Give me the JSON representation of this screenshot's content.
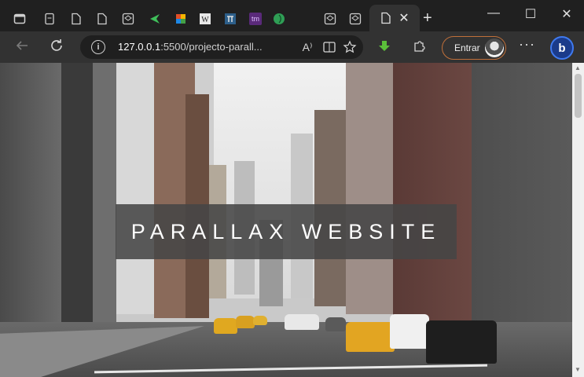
{
  "browser": {
    "tabs": [
      {
        "icon": "tab-actions-icon"
      },
      {
        "icon": "page-icon"
      },
      {
        "icon": "page-icon"
      },
      {
        "icon": "page-icon"
      },
      {
        "icon": "codepen-icon"
      },
      {
        "icon": "green-arrow-icon"
      },
      {
        "icon": "colorful-icon"
      },
      {
        "icon": "w-icon"
      },
      {
        "icon": "pi-icon"
      },
      {
        "icon": "tm-icon",
        "text": "tm"
      },
      {
        "icon": "leaf-icon"
      },
      {
        "icon": "codepen-icon"
      },
      {
        "icon": "codepen-icon"
      },
      {
        "icon": "page-icon",
        "active": true
      }
    ],
    "close_glyph": "✕",
    "newtab_glyph": "+",
    "window": {
      "minimize": "—",
      "maximize": "☐",
      "close": "✕"
    },
    "address": {
      "host": "127.0.0.1",
      "rest": ":5500/projecto-parall..."
    },
    "signin_label": "Entrar",
    "bing_label": "b"
  },
  "page": {
    "hero_title": "PARALLAX WEBSITE"
  }
}
